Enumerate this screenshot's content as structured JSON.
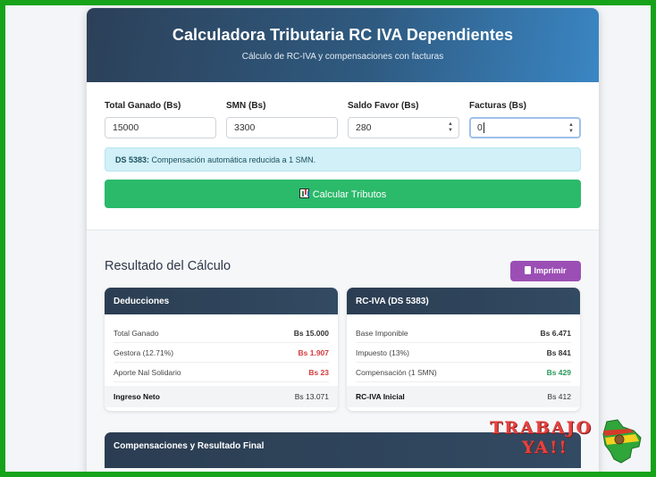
{
  "header": {
    "title": "Calculadora Tributaria RC IVA Dependientes",
    "subtitle": "Cálculo de RC-IVA y compensaciones con facturas"
  },
  "form": {
    "fields": [
      {
        "label": "Total Ganado (Bs)",
        "value": "15000"
      },
      {
        "label": "SMN (Bs)",
        "value": "3300"
      },
      {
        "label": "Saldo Favor (Bs)",
        "value": "280"
      },
      {
        "label": "Facturas (Bs)",
        "value": "0"
      }
    ],
    "alert_strong": "DS 5383:",
    "alert_text": " Compensación automática reducida a 1 SMN.",
    "calc_button": "Calcular Tributos"
  },
  "results": {
    "title": "Resultado del Cálculo",
    "print_button": "Imprimir",
    "deducciones": {
      "title": "Deducciones",
      "rows": [
        {
          "label": "Total Ganado",
          "value": "Bs 15.000"
        },
        {
          "label": "Gestora (12.71%)",
          "value": "Bs 1.907"
        },
        {
          "label": "Aporte Nal Solidario",
          "value": "Bs 23"
        }
      ],
      "total": {
        "label": "Ingreso Neto",
        "value": "Bs 13.071"
      }
    },
    "rciva": {
      "title": "RC-IVA (DS 5383)",
      "rows": [
        {
          "label": "Base Imponible",
          "value": "Bs 6.471"
        },
        {
          "label": "Impuesto (13%)",
          "value": "Bs 841"
        },
        {
          "label": "Compensación (1 SMN)",
          "value": "Bs 429"
        }
      ],
      "total": {
        "label": "RC-IVA Inicial",
        "value": "Bs 412"
      }
    },
    "final_panel_title": "Compensaciones y Resultado Final"
  },
  "logo": {
    "line1": "TRABAJO",
    "line2": "YA!!"
  },
  "colors": {
    "frame": "#16a31a",
    "header_start": "#2c4058",
    "header_end": "#3a86c4",
    "calc_button": "#2bb96a",
    "print_button": "#9b4fb5",
    "negative": "#d43c3c",
    "positive": "#2a9a5a"
  }
}
